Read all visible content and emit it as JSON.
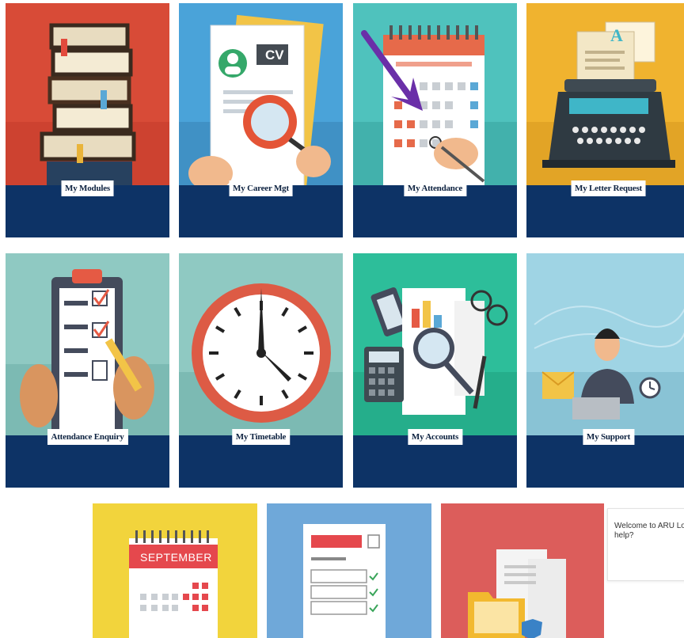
{
  "tiles": [
    {
      "label": "My Modules"
    },
    {
      "label": "My Career Mgt"
    },
    {
      "label": "My Attendance"
    },
    {
      "label": "My Letter Request"
    },
    {
      "label": "Attendance Enquiry"
    },
    {
      "label": "My Timetable"
    },
    {
      "label": "My Accounts"
    },
    {
      "label": "My Support"
    }
  ],
  "art_text": {
    "cv": "CV",
    "letter": "A",
    "september": "SEPTEMBER"
  },
  "chat": {
    "message": "Welcome to ARU Lon help?"
  },
  "colors": {
    "band": "#0d3366",
    "arrow": "#6a2fa8"
  }
}
